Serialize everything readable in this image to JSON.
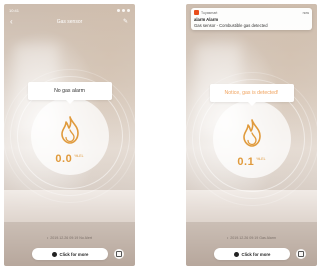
{
  "left_screen": {
    "status_time": "10:41",
    "nav_title": "Gas sensor",
    "callout_text": "No gas alarm",
    "reading_value": "0.0",
    "reading_unit": "%LEL",
    "record_text": "2019.12.26 09:19 No Alert",
    "more_label": "Click for more"
  },
  "right_screen": {
    "notification": {
      "app_name": "Tuyasmart",
      "time": "now",
      "title": "alarm Alarm",
      "body": "Gas sensor - Combustible gas detected"
    },
    "callout_text": "Notice, gas is detected!",
    "reading_value": "0.1",
    "reading_unit": "%LEL",
    "record_text": "2019.12.26 09:19 Gas Alarm",
    "more_label": "Click for more"
  },
  "colors": {
    "accent": "#e09a3c",
    "alert_text": "#f0a35e",
    "normal_text": "#333333",
    "app_icon": "#e94e1b"
  },
  "icons": {
    "flame": "flame-icon",
    "back": "chevron-left-icon",
    "edit": "pencil-icon",
    "more": "record-dot-icon",
    "side": "square-icon"
  }
}
